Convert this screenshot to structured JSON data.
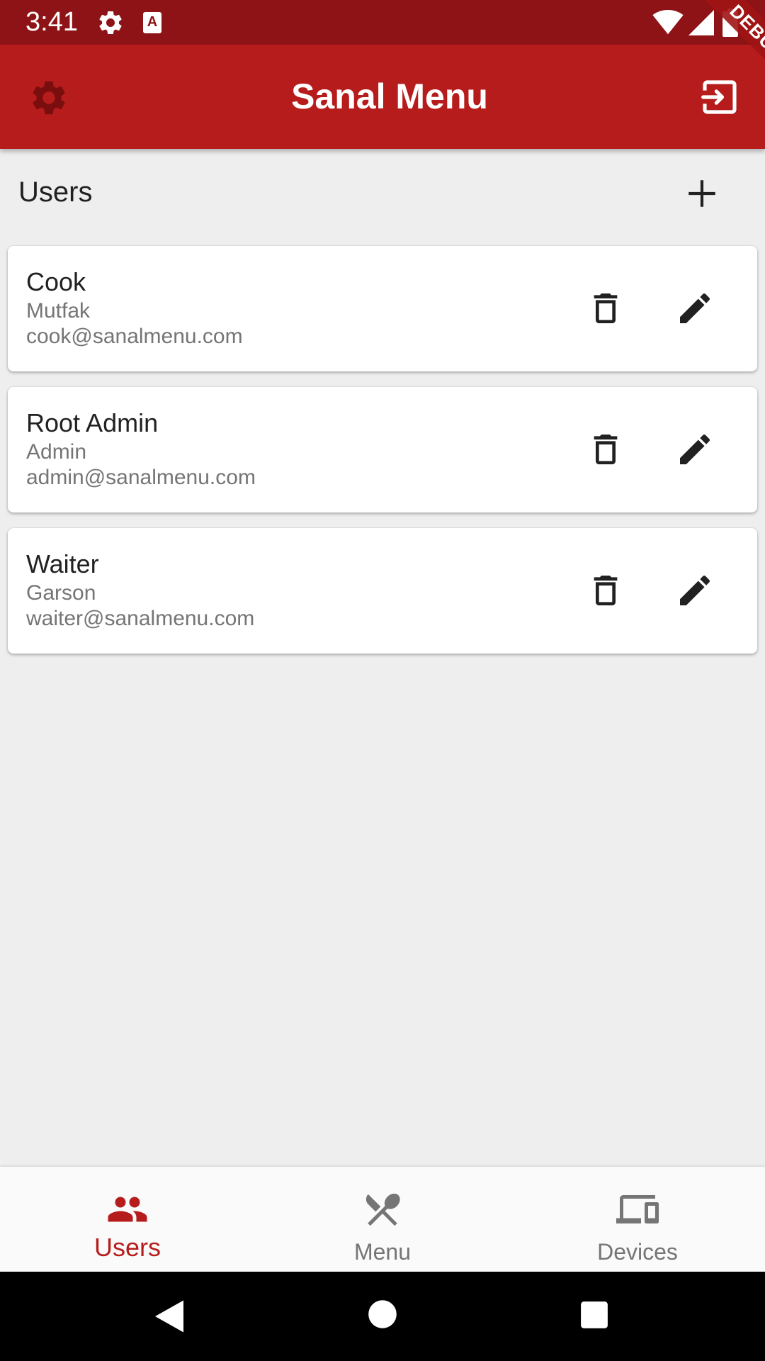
{
  "status_bar": {
    "time": "3:41",
    "icons": [
      "gear-icon",
      "text-a-icon",
      "wifi-icon",
      "signal-icon",
      "battery-icon"
    ]
  },
  "debug_banner": "DEBUG",
  "app_bar": {
    "title": "Sanal Menu",
    "left_icon": "gear-icon",
    "right_icon": "logout-icon"
  },
  "users_section": {
    "title": "Users",
    "add_icon": "plus-icon"
  },
  "users": [
    {
      "name": "Cook",
      "role": "Mutfak",
      "email": "cook@sanalmenu.com"
    },
    {
      "name": "Root Admin",
      "role": "Admin",
      "email": "admin@sanalmenu.com"
    },
    {
      "name": "Waiter",
      "role": "Garson",
      "email": "waiter@sanalmenu.com"
    }
  ],
  "bottom_nav": {
    "items": [
      {
        "label": "Users",
        "icon": "people-icon",
        "active": true
      },
      {
        "label": "Menu",
        "icon": "fork-spoon-icon",
        "active": false
      },
      {
        "label": "Devices",
        "icon": "devices-icon",
        "active": false
      }
    ]
  },
  "colors": {
    "status_bar": "#8e1316",
    "app_bar": "#b71c1c",
    "accent": "#b71c1c",
    "background": "#eeeeee",
    "card": "#ffffff",
    "secondary_text": "#757575"
  }
}
